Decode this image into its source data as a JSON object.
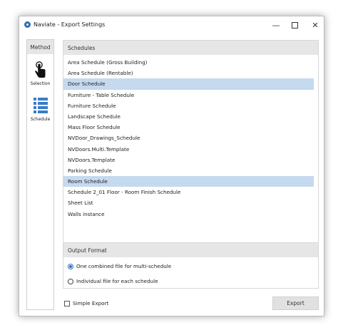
{
  "window": {
    "title": "Naviate - Export Settings",
    "minimize": "—",
    "close": "✕"
  },
  "method": {
    "header": "Method",
    "items": [
      {
        "label": "Selection",
        "icon": "touch-hand-icon"
      },
      {
        "label": "Schedule",
        "icon": "list-icon"
      }
    ]
  },
  "schedules": {
    "header": "Schedules",
    "items": [
      {
        "label": "Area Schedule (Gross Building)",
        "selected": false
      },
      {
        "label": "Area Schedule (Rentable)",
        "selected": false
      },
      {
        "label": "Door Schedule",
        "selected": true
      },
      {
        "label": "Furniture - Table Schedule",
        "selected": false
      },
      {
        "label": "Furniture Schedule",
        "selected": false
      },
      {
        "label": "Landscape Schedule",
        "selected": false
      },
      {
        "label": "Mass Floor Schedule",
        "selected": false
      },
      {
        "label": "NVDoor_Drawings_Schedule",
        "selected": false
      },
      {
        "label": "NVDoors.Multi.Template",
        "selected": false
      },
      {
        "label": "NVDoors.Template",
        "selected": false
      },
      {
        "label": "Parking Schedule",
        "selected": false
      },
      {
        "label": "Room Schedule",
        "selected": true
      },
      {
        "label": "Schedule 2_01 Floor - Room Finish Schedule",
        "selected": false
      },
      {
        "label": "Sheet List",
        "selected": false
      },
      {
        "label": "Walls instance",
        "selected": false
      }
    ]
  },
  "output_format": {
    "header": "Output Format",
    "options": [
      {
        "label": "One combined file for multi-schedule",
        "checked": true
      },
      {
        "label": "Individual file for each schedule",
        "checked": false
      }
    ]
  },
  "footer": {
    "simple_export_label": "Simple Export",
    "simple_export_checked": false,
    "export_button": "Export"
  },
  "colors": {
    "accent": "#2f6fc0",
    "selection": "#c5d9ef",
    "icon_blue": "#3a7cc8"
  }
}
